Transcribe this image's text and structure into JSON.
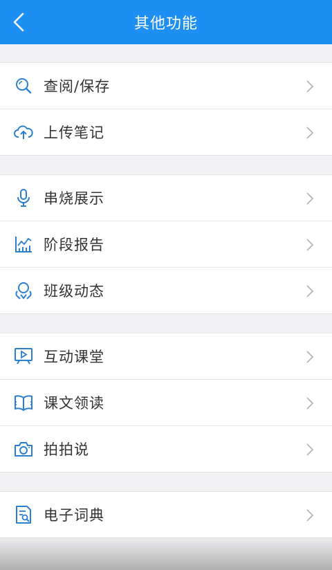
{
  "header": {
    "title": "其他功能",
    "back_icon": "chevron-left-icon"
  },
  "colors": {
    "accent": "#1d8ff3",
    "icon": "#2a7fd0"
  },
  "groups": [
    {
      "items": [
        {
          "label": "查阅/保存",
          "icon": "search-icon"
        },
        {
          "label": "上传笔记",
          "icon": "cloud-upload-icon"
        }
      ]
    },
    {
      "items": [
        {
          "label": "串烧展示",
          "icon": "microphone-icon"
        },
        {
          "label": "阶段报告",
          "icon": "chart-icon"
        },
        {
          "label": "班级动态",
          "icon": "group-icon"
        }
      ]
    },
    {
      "items": [
        {
          "label": "互动课堂",
          "icon": "video-board-icon"
        },
        {
          "label": "课文领读",
          "icon": "open-book-icon"
        },
        {
          "label": "拍拍说",
          "icon": "camera-icon"
        }
      ]
    },
    {
      "items": [
        {
          "label": "电子词典",
          "icon": "dictionary-icon"
        }
      ]
    }
  ]
}
